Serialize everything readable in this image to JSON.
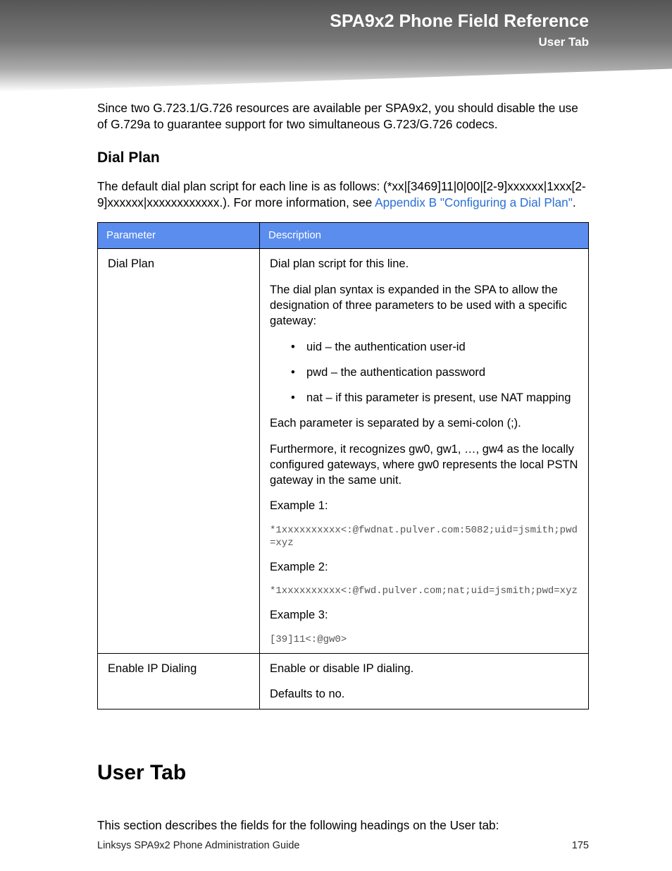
{
  "header": {
    "title": "SPA9x2 Phone Field Reference",
    "subtitle": "User Tab"
  },
  "intro": "Since two G.723.1/G.726 resources are available per SPA9x2, you should disable the use of G.729a to guarantee support for two simultaneous G.723/G.726 codecs.",
  "dialplan": {
    "heading": "Dial Plan",
    "text_before_link": "The default dial plan script for each line is as follows: (*xx|[3469]11|0|00|[2-9]xxxxxx|1xxx[2-9]xxxxxx|xxxxxxxxxxxx.). For more information, see ",
    "link_text": "Appendix B \"Configuring a Dial Plan\"",
    "text_after_link": "."
  },
  "table": {
    "headers": {
      "param": "Parameter",
      "desc": "Description"
    },
    "rows": [
      {
        "param": "Dial Plan",
        "d1": "Dial plan script for this line.",
        "d2": "The dial plan syntax is expanded in the SPA to allow the designation of three parameters to be used with a specific gateway:",
        "li1": "uid – the authentication user-id",
        "li2": "pwd – the authentication password",
        "li3": "nat – if this parameter is present, use NAT mapping",
        "d3": "Each parameter is separated by a semi-colon (;).",
        "d4": "Furthermore, it recognizes gw0, gw1, …, gw4 as the locally configured gateways, where gw0 represents the local PSTN gateway in the same unit.",
        "ex1label": "Example 1:",
        "ex1code": "*1xxxxxxxxxx<:@fwdnat.pulver.com:5082;uid=jsmith;pwd=xyz",
        "ex2label": "Example 2:",
        "ex2code": "*1xxxxxxxxxx<:@fwd.pulver.com;nat;uid=jsmith;pwd=xyz",
        "ex3label": "Example 3:",
        "ex3code": "[39]11<:@gw0>"
      },
      {
        "param": "Enable IP Dialing",
        "d1": "Enable or disable IP dialing.",
        "d2": "Defaults to no."
      }
    ]
  },
  "usertab": {
    "heading": "User Tab",
    "text": "This section describes the fields for the following headings on the User tab:"
  },
  "footer": {
    "left": "Linksys SPA9x2 Phone Administration Guide",
    "right": "175"
  }
}
